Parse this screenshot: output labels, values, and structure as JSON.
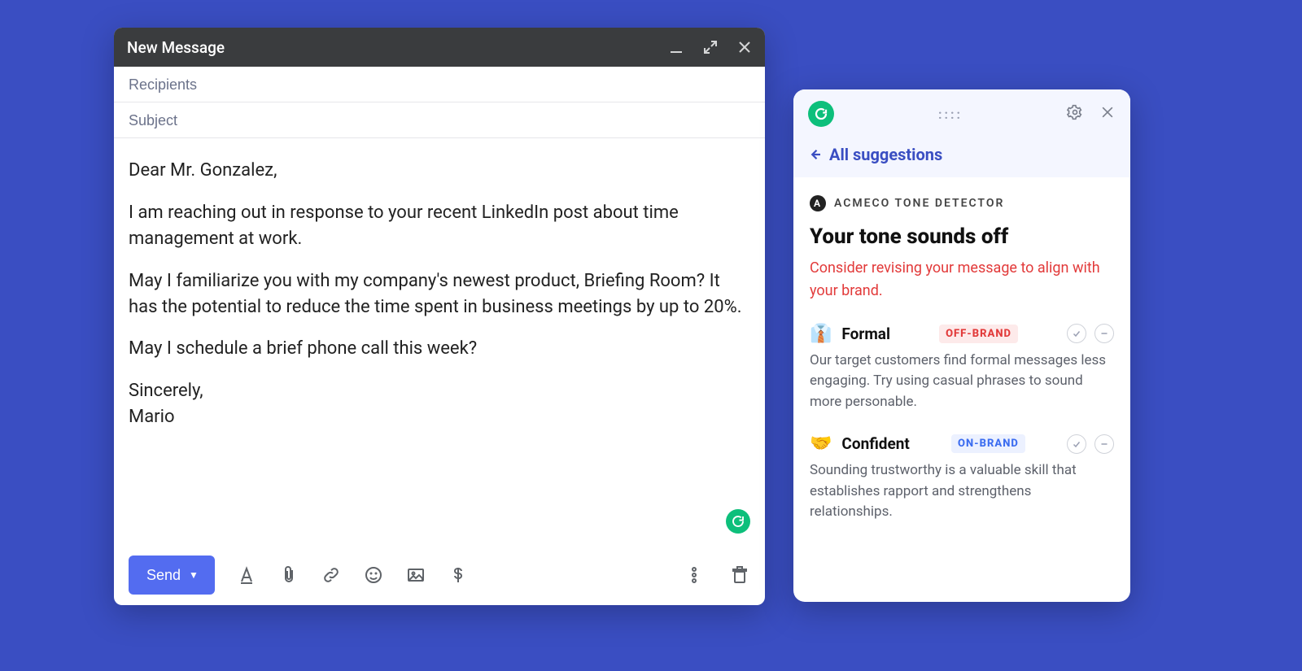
{
  "compose": {
    "title": "New Message",
    "recipients_placeholder": "Recipients",
    "subject_placeholder": "Subject",
    "body": {
      "p1": "Dear Mr. Gonzalez,",
      "p2": "I am reaching out in response to your recent LinkedIn post about time management at work.",
      "p3": "May I familiarize you with my company's newest product, Briefing Room? It has the potential to reduce the time spent in business meetings by up to 20%.",
      "p4": "May I schedule a brief phone call this week?",
      "p5": "Sincerely,",
      "p6": "Mario"
    },
    "send_label": "Send"
  },
  "panel": {
    "all_suggestions": "All suggestions",
    "detector_label": "ACMECO TONE DETECTOR",
    "detector_badge": "A",
    "headline": "Your tone sounds off",
    "advice": "Consider revising your message to align with your brand.",
    "tones": [
      {
        "emoji": "👔",
        "name": "Formal",
        "tag": "OFF-BRAND",
        "tag_kind": "off",
        "desc": "Our target customers find formal messages less engaging. Try using casual phrases to sound more personable."
      },
      {
        "emoji": "🤝",
        "name": "Confident",
        "tag": "ON-BRAND",
        "tag_kind": "on",
        "desc": "Sounding trustworthy is a valuable skill that establishes rapport and strengthens relationships."
      }
    ]
  }
}
